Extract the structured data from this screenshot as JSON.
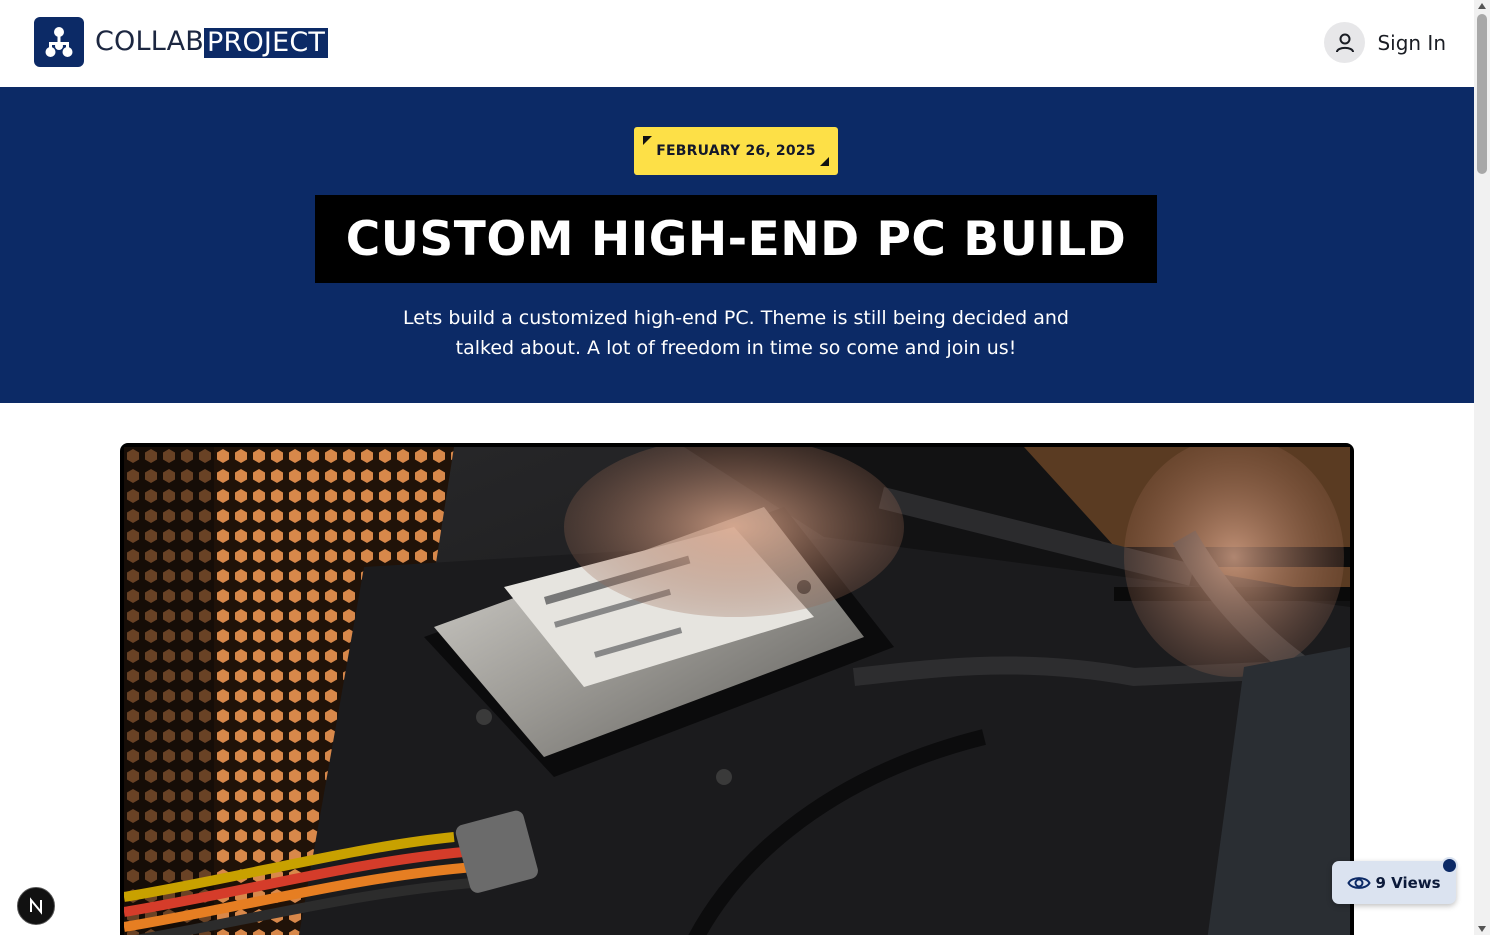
{
  "header": {
    "logo": {
      "word_primary": "COLLAB",
      "word_highlight": "PROJECT",
      "icon": "hierarchy-icon"
    },
    "sign_in": {
      "label": "Sign In",
      "icon": "user-icon"
    }
  },
  "hero": {
    "date": "FEBRUARY 26, 2025",
    "title": "CUSTOM HIGH-END PC BUILD",
    "description": "Lets build a customized high-end PC. Theme is still being decided and talked about. A lot of freedom in time so come and join us!"
  },
  "image": {
    "alt": "Hands installing a hard drive inside a PC case"
  },
  "views": {
    "label": "9 Views",
    "icon": "eye-icon"
  },
  "dev_badge": {
    "letter": "N"
  },
  "colors": {
    "brand_navy": "#0c2a66",
    "badge_yellow": "#fde047",
    "title_bg": "#000000"
  }
}
